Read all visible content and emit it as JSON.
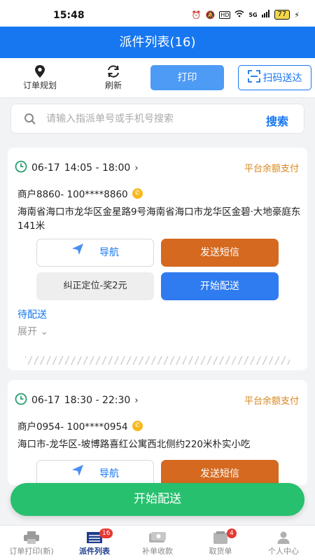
{
  "status_bar": {
    "time": "15:48",
    "battery": "77",
    "network": "5G",
    "hd": "HD"
  },
  "header": {
    "title": "派件列表(16)"
  },
  "toolbar": {
    "route_plan_label": "订单规划",
    "refresh_label": "刷新",
    "print_label": "打印",
    "scan_label": "扫码送达"
  },
  "search": {
    "placeholder": "请输入指派单号或手机号搜索",
    "button_label": "搜索"
  },
  "orders": [
    {
      "date": "06-17",
      "time_range": "14:05 - 18:00",
      "payment": "平台余额支付",
      "merchant": "商户8860- 100****8860",
      "address": "海南省海口市龙华区金星路9号海南省海口市龙华区金碧·大地豪庭东141米",
      "nav_label": "导航",
      "sms_label": "发送短信",
      "fix_label": "纠正定位-奖2元",
      "start_label": "开始配送",
      "status": "待配送",
      "expand_label": "展开"
    },
    {
      "date": "06-17",
      "time_range": "18:30 - 22:30",
      "payment": "平台余额支付",
      "merchant": "商户0954- 100****0954",
      "address": "海口市-龙华区-坡博路喜红公寓西北侧约220米朴实小吃",
      "nav_label": "导航",
      "sms_label": "发送短信"
    }
  ],
  "bottom_action": {
    "label": "开始配送"
  },
  "tabbar": {
    "tabs": [
      {
        "label": "订单打印(新)",
        "icon": "printer-icon"
      },
      {
        "label": "派件列表",
        "icon": "list-icon",
        "badge": "16"
      },
      {
        "label": "补单收款",
        "icon": "cash-icon"
      },
      {
        "label": "取货单",
        "icon": "pickup-icon",
        "badge": "4"
      },
      {
        "label": "个人中心",
        "icon": "person-icon"
      }
    ]
  },
  "colors": {
    "primary": "#1677f0",
    "sms": "#d4691f",
    "start": "#27c06e",
    "payment": "#d9861a"
  }
}
